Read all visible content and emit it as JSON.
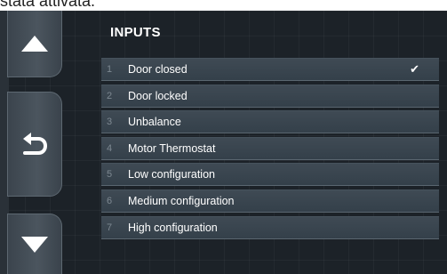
{
  "caption_fragment": "stata attivata.",
  "screen": {
    "title": "INPUTS",
    "side_buttons": [
      {
        "name": "scroll-up",
        "icon": "triangle-up-icon"
      },
      {
        "name": "back",
        "icon": "return-arrow-icon"
      },
      {
        "name": "scroll-down",
        "icon": "triangle-down-icon"
      }
    ],
    "inputs": [
      {
        "number": "1",
        "label": "Door closed",
        "active": true,
        "check": "✔"
      },
      {
        "number": "2",
        "label": "Door locked",
        "active": false
      },
      {
        "number": "3",
        "label": "Unbalance",
        "active": false
      },
      {
        "number": "4",
        "label": "Motor Thermostat",
        "active": false
      },
      {
        "number": "5",
        "label": "Low configuration",
        "active": false
      },
      {
        "number": "6",
        "label": "Medium configuration",
        "active": false
      },
      {
        "number": "7",
        "label": "High configuration",
        "active": false
      }
    ]
  }
}
